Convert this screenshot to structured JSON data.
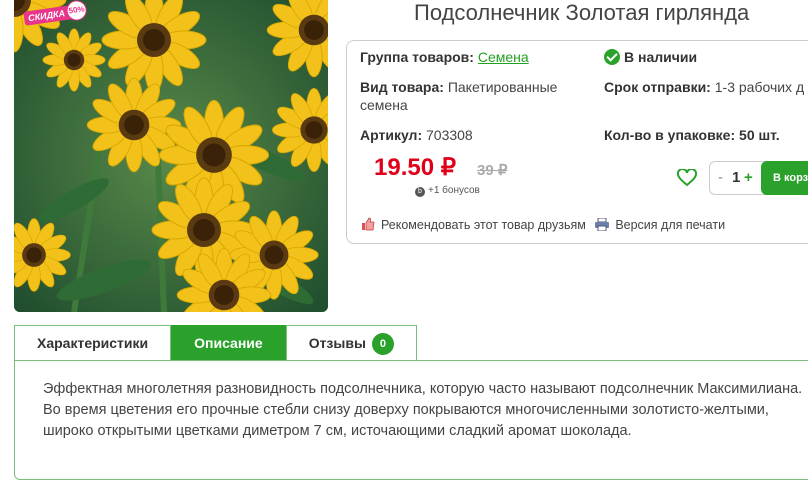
{
  "product": {
    "title": "Подсолнечник Золотая гирлянда",
    "discount_badge": "СКИДКА",
    "discount_pct": "50%"
  },
  "info": {
    "group_label": "Группа товаров:",
    "group_value": "Семена",
    "availability": "В наличии",
    "type_label": "Вид товара:",
    "type_value_1": "Пакетированные",
    "type_value_2": "семена",
    "ship_label": "Срок отправки:",
    "ship_value": "1-3 рабочих д",
    "sku_label": "Артикул:",
    "sku_value": "703308",
    "pack_label": "Кол-во в упаковке:",
    "pack_value": "50 шт.",
    "price": "19.50 ₽",
    "old_price": "39 ₽",
    "bonus_icon": "b",
    "bonus": "+1 бонусов",
    "qty": "1",
    "qty_minus": "-",
    "qty_plus": "+",
    "cart_label": "В корз",
    "recommend": "Рекомендовать этот товар друзьям",
    "print": "Версия для печати"
  },
  "tabs": [
    {
      "label": "Характеристики"
    },
    {
      "label": "Описание"
    },
    {
      "label": "Отзывы",
      "count": "0"
    }
  ],
  "description": "Эффектная многолетняя разновидность подсолнечника, которую часто называют подсолнечник Максимилиана. Во время цветения его прочные стебли снизу доверху покрываются многочисленными золотисто-желтыми, широко открытыми цветками диметром 7 см, источающими сладкий аромат шоколада.",
  "colors": {
    "accent": "#2aa12a",
    "price": "#e0001a",
    "badge": "#e8358a"
  },
  "icons": [
    "check-icon",
    "heart-icon",
    "thumbs-up-icon",
    "printer-icon"
  ]
}
